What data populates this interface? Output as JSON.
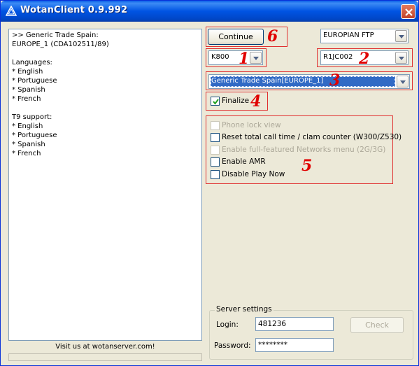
{
  "window": {
    "title": "WotanClient 0.9.992",
    "app_icon": "wotan-triangle-icon",
    "close_icon": "close-icon"
  },
  "info_pane": {
    "text": ">> Generic Trade Spain:\nEUROPE_1 (CDA102511/89)\n\nLanguages:\n* English\n* Portuguese\n* Spanish\n* French\n\nT9 support:\n* English\n* Portuguese\n* Spanish\n* French"
  },
  "footer": {
    "visit_text": "Visit us at wotanserver.com!"
  },
  "controls": {
    "continue_label": "Continue",
    "ftp_select": "EUROPIAN FTP",
    "phone_model": "K800",
    "firmware": "R1JC002",
    "region_select": "Generic Trade Spain[EUROPE_1]",
    "finalize": {
      "label": "Finalize",
      "checked": true
    }
  },
  "options": [
    {
      "label": "Phone lock view",
      "enabled": false,
      "checked": false
    },
    {
      "label": "Reset total call time / clam counter (W300/Z530)",
      "enabled": true,
      "checked": false
    },
    {
      "label": "Enable full-featured Networks menu (2G/3G)",
      "enabled": false,
      "checked": false
    },
    {
      "label": "Enable AMR",
      "enabled": true,
      "checked": false
    },
    {
      "label": "Disable Play Now",
      "enabled": true,
      "checked": false
    }
  ],
  "annotations": {
    "n1": "1",
    "n2": "2",
    "n3": "3",
    "n4": "4",
    "n5": "5",
    "n6": "6",
    "color": "#e00000"
  },
  "server": {
    "group_label": "Server settings",
    "login_label": "Login:",
    "login_value": "481236",
    "password_label": "Password:",
    "password_value": "********",
    "check_label": "Check"
  },
  "colors": {
    "titlebar": "#0054e3",
    "window_bg": "#ece9d8",
    "selection": "#316ac5"
  }
}
